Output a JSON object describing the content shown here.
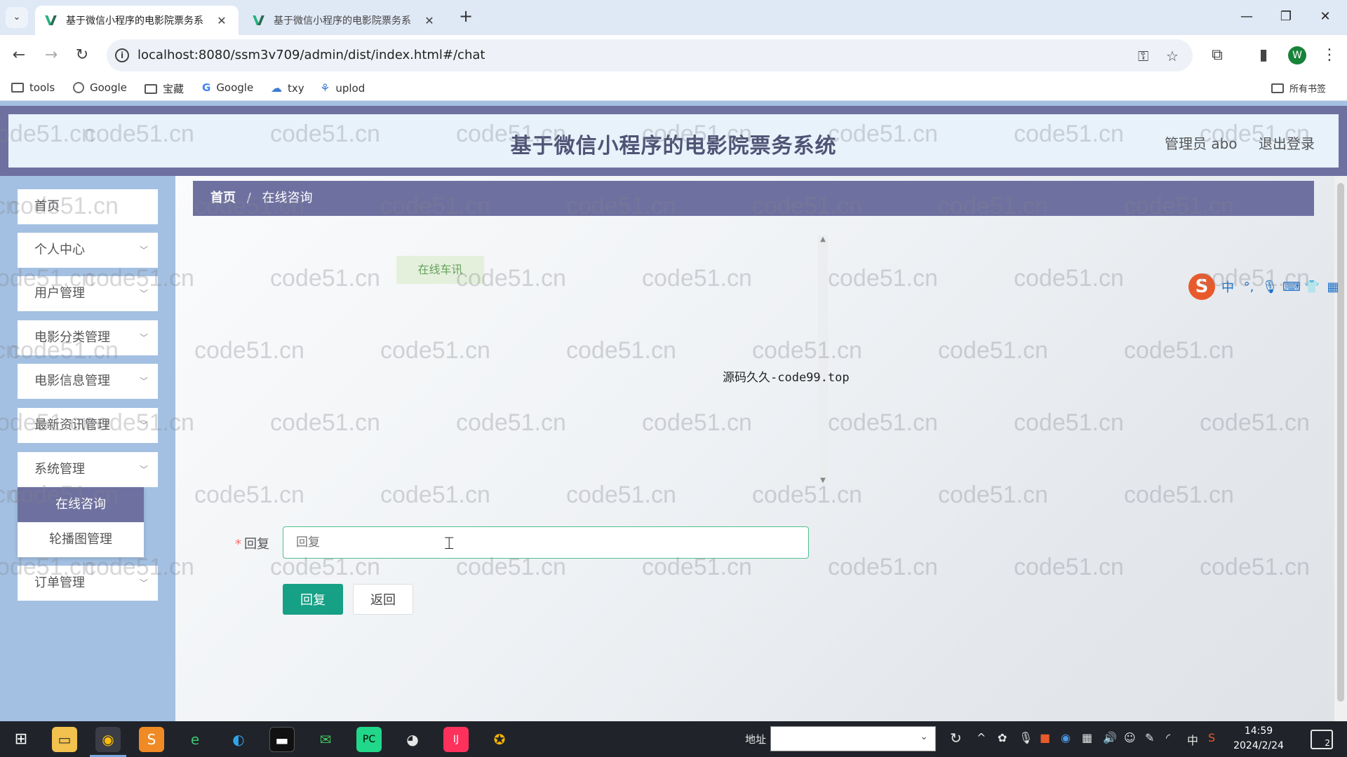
{
  "browser": {
    "tabs": [
      {
        "title": "基于微信小程序的电影院票务系",
        "active": true
      },
      {
        "title": "基于微信小程序的电影院票务系",
        "active": false
      }
    ],
    "url": "localhost:8080/ssm3v709/admin/dist/index.html#/chat",
    "profile_initial": "W",
    "bookmarks": [
      {
        "label": "tools",
        "icon": "folder-icon"
      },
      {
        "label": "Google",
        "icon": "globe-icon"
      },
      {
        "label": "宝藏",
        "icon": "folder-icon"
      },
      {
        "label": "Google",
        "icon": "google-icon"
      },
      {
        "label": "txy",
        "icon": "cloud-icon"
      },
      {
        "label": "uplod",
        "icon": "share-icon"
      }
    ],
    "all_bookmarks_label": "所有书签"
  },
  "header": {
    "title": "基于微信小程序的电影院票务系统",
    "user": "管理员 abo",
    "logout": "退出登录"
  },
  "sidebar": {
    "items": [
      {
        "label": "首页",
        "expandable": false
      },
      {
        "label": "个人中心",
        "expandable": true
      },
      {
        "label": "用户管理",
        "expandable": true
      },
      {
        "label": "电影分类管理",
        "expandable": true
      },
      {
        "label": "电影信息管理",
        "expandable": true
      },
      {
        "label": "最新资讯管理",
        "expandable": true
      },
      {
        "label": "系统管理",
        "expandable": true
      },
      {
        "label": "订单管理",
        "expandable": true
      }
    ],
    "submenu": [
      {
        "label": "在线咨询",
        "active": true
      },
      {
        "label": "轮播图管理",
        "active": false
      }
    ]
  },
  "breadcrumb": {
    "home": "首页",
    "separator": "/",
    "current": "在线咨询"
  },
  "chat": {
    "messages": [
      {
        "text": "在线车讯"
      }
    ],
    "overlay_text": "源码久久-code99.top"
  },
  "form": {
    "reply_label": "回复",
    "reply_placeholder": "回复",
    "reply_value": "",
    "submit_label": "回复",
    "back_label": "返回"
  },
  "watermark_text": "code51.cn",
  "ime": {
    "labels": [
      "中",
      "°,"
    ]
  },
  "taskbar": {
    "address_label": "地址",
    "time": "14:59",
    "date": "2024/2/24",
    "input_method": "中",
    "notification_count": "2"
  },
  "colors": {
    "primary": "#6e71a0",
    "accent_green": "#16a085",
    "page_bg": "#a4c1e2"
  }
}
